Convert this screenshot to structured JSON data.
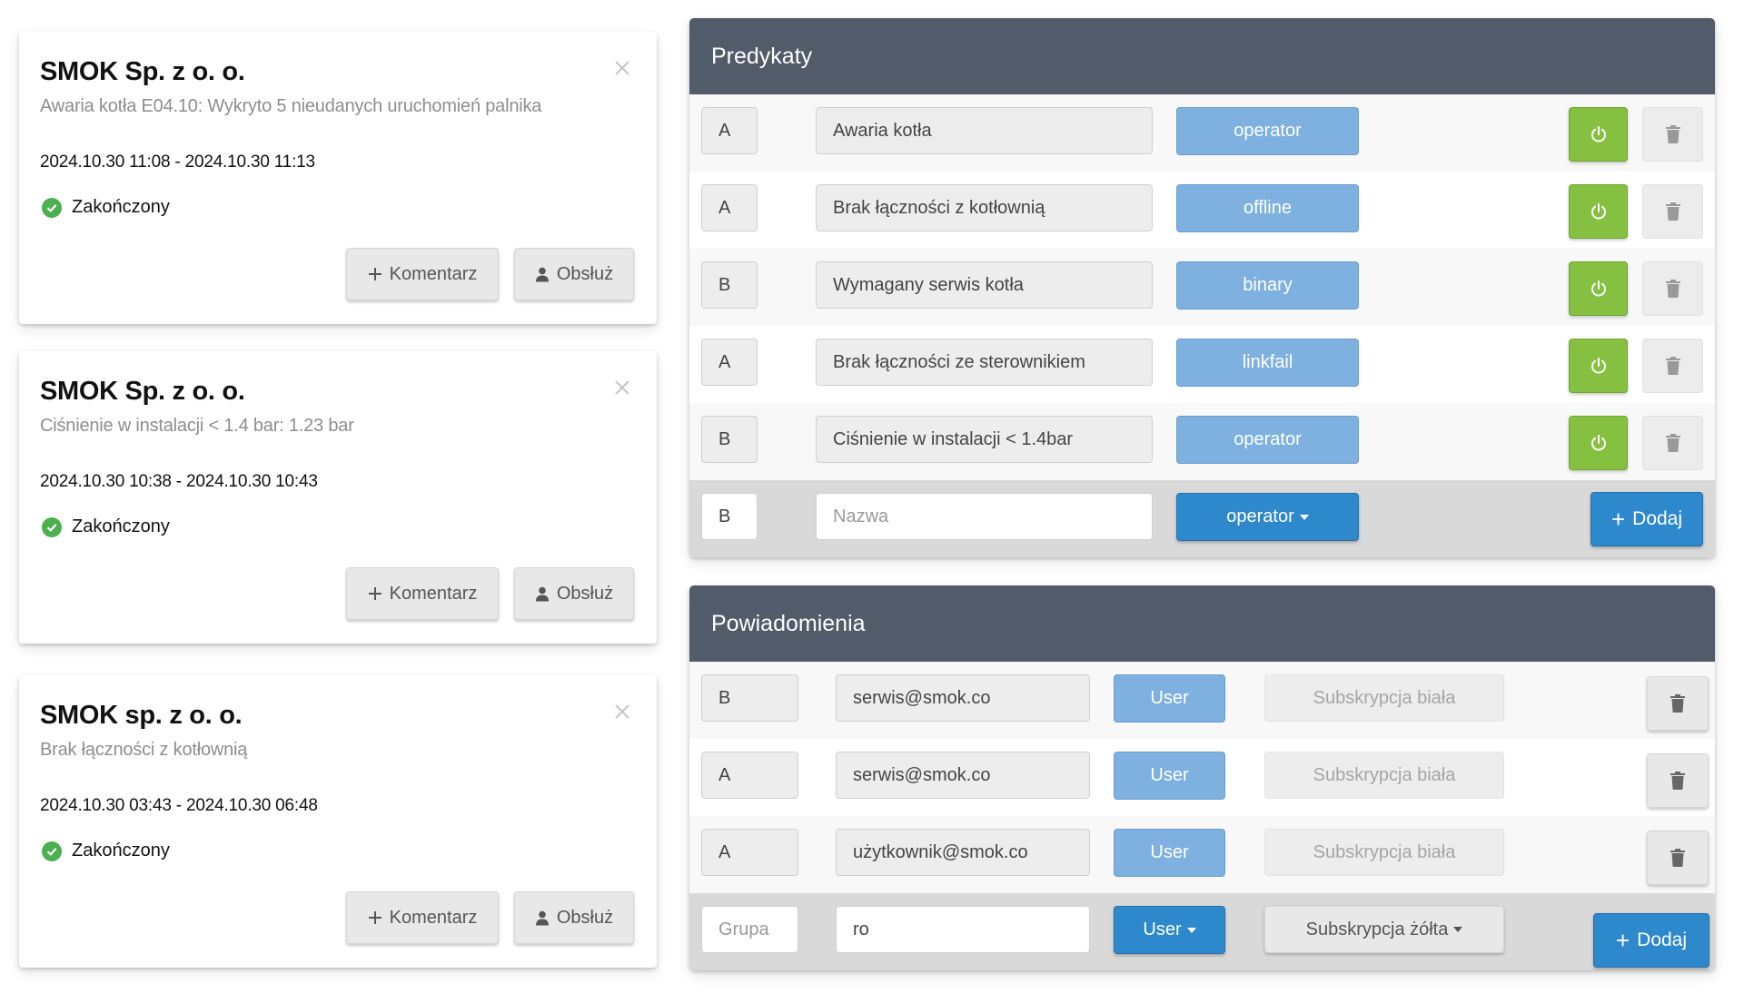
{
  "cards": [
    {
      "title": "SMOK Sp. z o. o.",
      "subtitle": "Awaria kotła E04.10: Wykryto 5 nieudanych uruchomień palnika",
      "dates": "2024.10.30 11:08 - 2024.10.30 11:13",
      "status": "Zakończony",
      "comment_label": "Komentarz",
      "handle_label": "Obsłuż"
    },
    {
      "title": "SMOK Sp. z o. o.",
      "subtitle": "Ciśnienie w instalacji < 1.4 bar: 1.23 bar",
      "dates": "2024.10.30 10:38 - 2024.10.30 10:43",
      "status": "Zakończony",
      "comment_label": "Komentarz",
      "handle_label": "Obsłuż"
    },
    {
      "title": "SMOK sp. z o. o.",
      "subtitle": "Brak łączności z kotłownią",
      "dates": "2024.10.30 03:43 - 2024.10.30 06:48",
      "status": "Zakończony",
      "comment_label": "Komentarz",
      "handle_label": "Obsłuż"
    }
  ],
  "predicates": {
    "title": "Predykaty",
    "rows": [
      {
        "group": "A",
        "name": "Awaria kotła",
        "type": "operator"
      },
      {
        "group": "A",
        "name": "Brak łączności z kotłownią",
        "type": "offline"
      },
      {
        "group": "B",
        "name": "Wymagany serwis kotła",
        "type": "binary"
      },
      {
        "group": "A",
        "name": "Brak łączności ze sterownikiem",
        "type": "linkfail"
      },
      {
        "group": "B",
        "name": "Ciśnienie w instalacji < 1.4bar",
        "type": "operator"
      }
    ],
    "add_row": {
      "group_value": "B",
      "name_placeholder": "Nazwa",
      "type_selected": "operator",
      "add_label": "Dodaj"
    }
  },
  "notifications": {
    "title": "Powiadomienia",
    "rows": [
      {
        "group": "B",
        "email": "serwis@smok.co",
        "role": "User",
        "subscription": "Subskrypcja biała"
      },
      {
        "group": "A",
        "email": "serwis@smok.co",
        "role": "User",
        "subscription": "Subskrypcja biała"
      },
      {
        "group": "A",
        "email": "użytkownik@smok.co",
        "role": "User",
        "subscription": "Subskrypcja biała"
      }
    ],
    "add_row": {
      "group_placeholder": "Grupa",
      "email_value": "ro",
      "role_selected": "User",
      "subscription_selected": "Subskrypcja żółta",
      "add_label": "Dodaj"
    }
  },
  "colors": {
    "panel_header": "#525b69",
    "type_button": "#7eb1df",
    "primary_button": "#2d89cc",
    "power_button": "#86c041",
    "status_ok": "#4caf50"
  }
}
